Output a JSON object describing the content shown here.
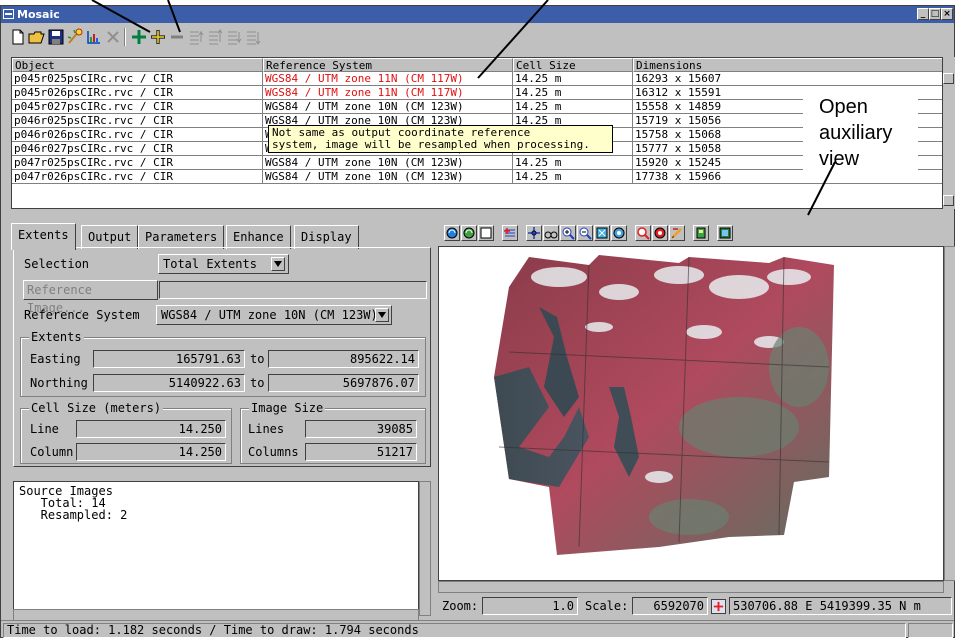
{
  "window": {
    "title": "Mosaic"
  },
  "table": {
    "headers": [
      "Object",
      "Reference System",
      "Cell Size",
      "Dimensions"
    ],
    "rows": [
      {
        "object": "p045r025psCIRc.rvc / CIR",
        "ref": "WGS84 / UTM zone 11N (CM 117W)",
        "cell": "14.25 m",
        "dims": "16293 x 15607",
        "mismatch": true
      },
      {
        "object": "p045r026psCIRc.rvc / CIR",
        "ref": "WGS84 / UTM zone 11N (CM 117W)",
        "cell": "14.25 m",
        "dims": "16312 x 15591",
        "mismatch": true
      },
      {
        "object": "p045r027psCIRc.rvc / CIR",
        "ref": "WGS84 / UTM zone 10N (CM 123W)",
        "cell": "14.25 m",
        "dims": "15558 x 14859",
        "mismatch": false
      },
      {
        "object": "p046r025psCIRc.rvc / CIR",
        "ref": "WGS84 / UTM zone 10N (CM 123W)",
        "cell": "14.25 m",
        "dims": "15719 x 15056",
        "mismatch": false
      },
      {
        "object": "p046r026psCIRc.rvc / CIR",
        "ref": "WGS84 / UTM zone 10N (CM 123W)",
        "cell": "14.25 m",
        "dims": "15758 x 15068",
        "mismatch": false
      },
      {
        "object": "p046r027psCIRc.rvc / CIR",
        "ref": "WGS84 / UTM zone 10N (CM 123W)",
        "cell": "14.25 m",
        "dims": "15777 x 15058",
        "mismatch": false
      },
      {
        "object": "p047r025psCIRc.rvc / CIR",
        "ref": "WGS84 / UTM zone 10N (CM 123W)",
        "cell": "14.25 m",
        "dims": "15920 x 15245",
        "mismatch": false
      },
      {
        "object": "p047r026psCIRc.rvc / CIR",
        "ref": "WGS84 / UTM zone 10N (CM 123W)",
        "cell": "14.25 m",
        "dims": "17738 x 15966",
        "mismatch": false
      }
    ]
  },
  "tooltip": {
    "line1": "Not same as output coordinate reference",
    "line2": "system, image will be resampled when processing."
  },
  "callout": {
    "line1": "Open",
    "line2": "auxiliary",
    "line3": "view"
  },
  "tabs": [
    "Extents",
    "Output",
    "Parameters",
    "Enhance",
    "Display"
  ],
  "extents_tab": {
    "selection_label": "Selection",
    "selection_value": "Total Extents",
    "reference_image_button": "Reference Image...",
    "reference_system_label": "Reference System",
    "reference_system_value": "WGS84 / UTM zone 10N (CM 123W)",
    "extents_group": "Extents",
    "easting_label": "Easting",
    "easting_from": "165791.63",
    "easting_to": "895622.14",
    "northing_label": "Northing",
    "northing_from": "5140922.63",
    "northing_to": "5697876.07",
    "to_label": "to",
    "cell_size_group": "Cell Size (meters)",
    "line_label": "Line",
    "line_value": "14.250",
    "column_label": "Column",
    "column_value": "14.250",
    "image_size_group": "Image Size",
    "lines_label": "Lines",
    "lines_value": "39085",
    "columns_label": "Columns",
    "columns_value": "51217"
  },
  "source_images": {
    "title": "Source Images",
    "total": "   Total: 14",
    "resampled": "   Resampled: 2"
  },
  "view_status": {
    "zoom_label": "Zoom:",
    "zoom_value": "1.0",
    "scale_label": "Scale:",
    "scale_value": "6592070",
    "coords": "530706.88 E  5419399.35 N m"
  },
  "status": {
    "text": "Time to load: 1.182 seconds  /  Time to draw: 1.794 seconds"
  },
  "colors": {
    "titlebar": "#3c5ea8",
    "mismatch_red": "#e01010",
    "tooltip_bg": "#ffffcc",
    "chrome": "#c0c0c0"
  }
}
